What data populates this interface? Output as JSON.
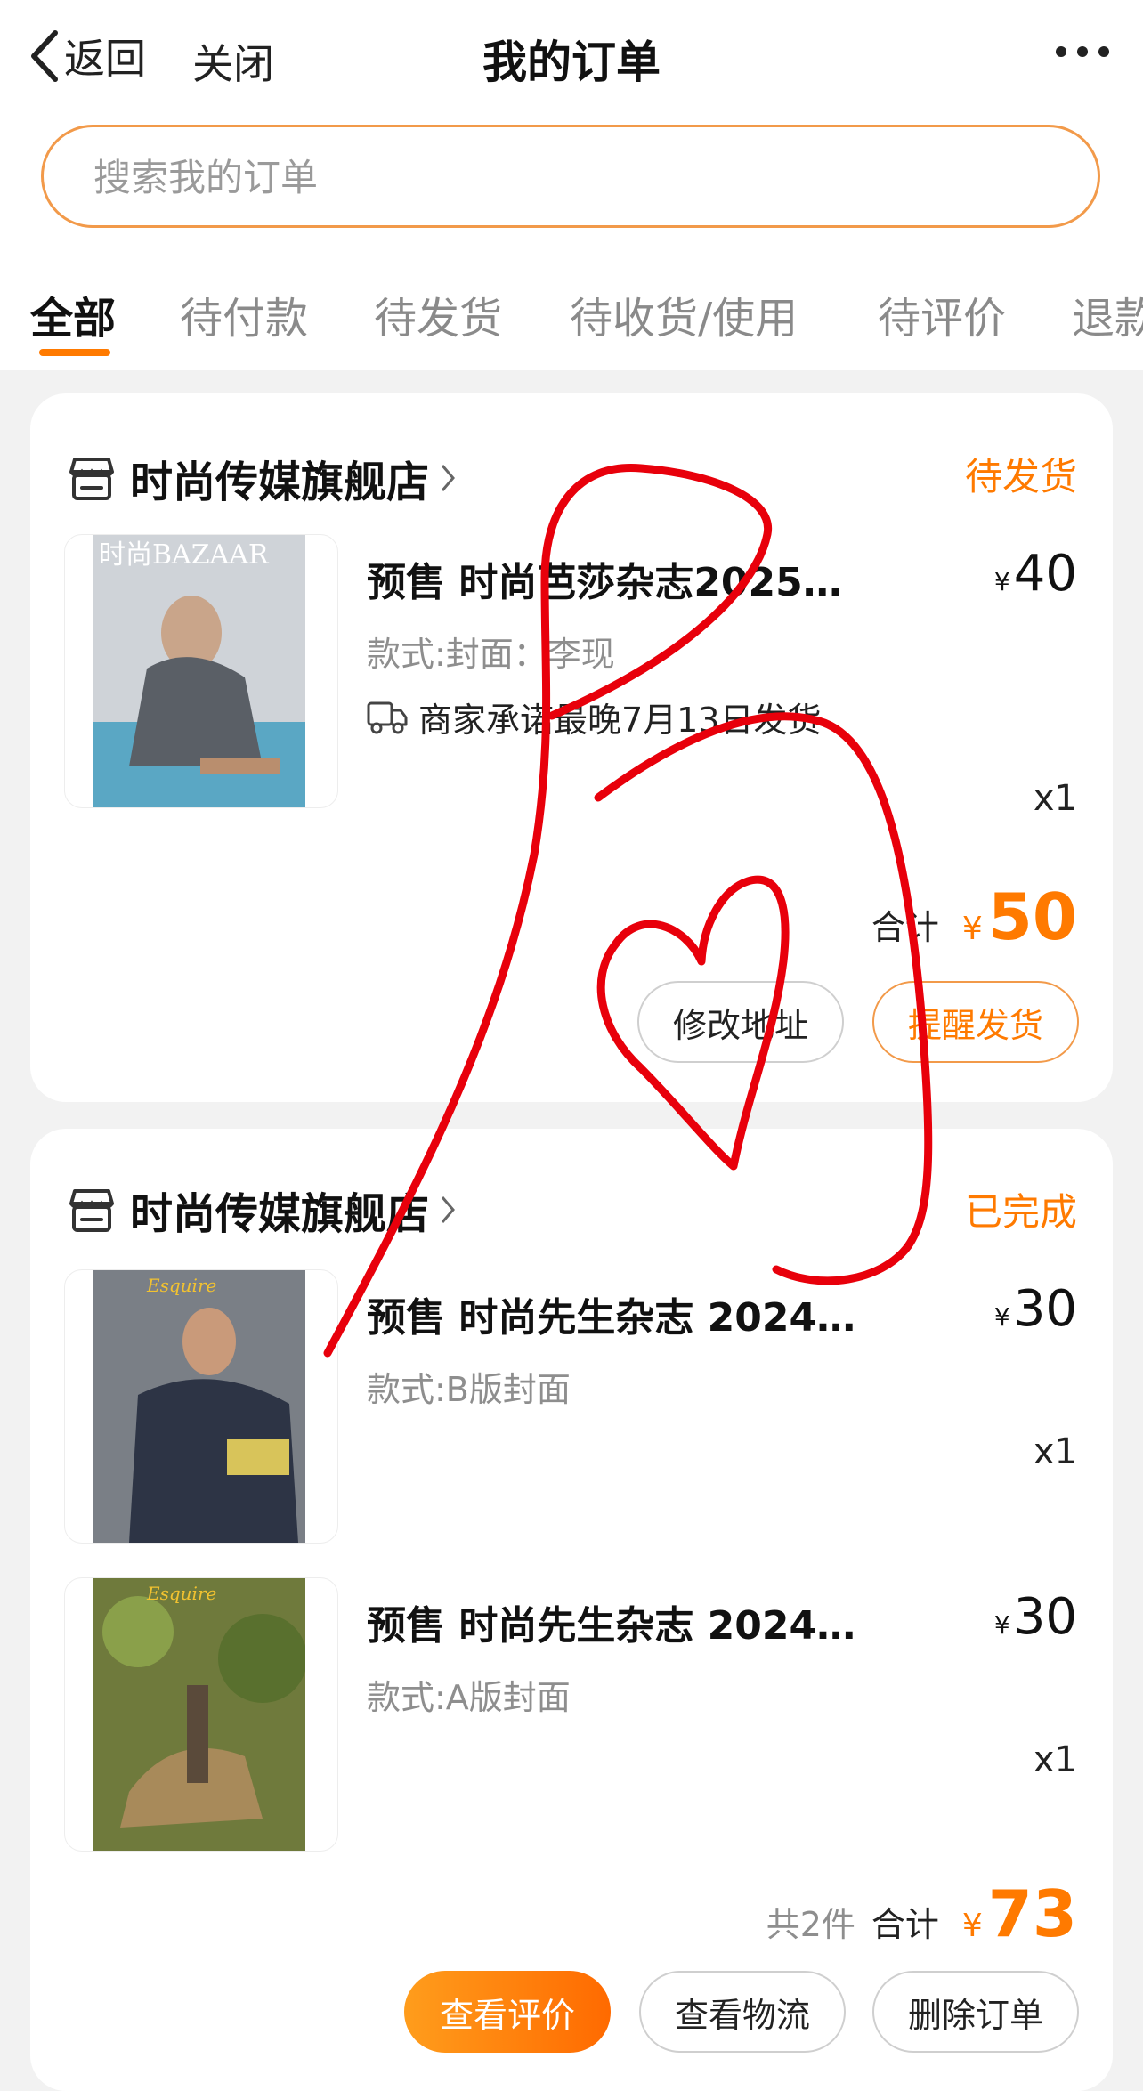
{
  "nav": {
    "back_label": "返回",
    "close_label": "关闭",
    "title": "我的订单",
    "more_icon": "more-dots-icon"
  },
  "search": {
    "placeholder": "搜索我的订单",
    "value": ""
  },
  "tabs": [
    {
      "label": "全部",
      "active": true
    },
    {
      "label": "待付款",
      "active": false
    },
    {
      "label": "待发货",
      "active": false
    },
    {
      "label": "待收货/使用",
      "active": false
    },
    {
      "label": "待评价",
      "active": false
    },
    {
      "label": "退款",
      "active": false
    }
  ],
  "colors": {
    "accent": "#ff7a00",
    "scribble": "#e8000b"
  },
  "orders": [
    {
      "store_name": "时尚传媒旗舰店",
      "status": "待发货",
      "items": [
        {
          "title": "预售 时尚芭莎杂志2025…",
          "variant": "款式:封面：李现",
          "promise": "商家承诺最晚7月13日发货",
          "price_symbol": "¥",
          "price": "40",
          "qty": "x1"
        }
      ],
      "total_label": "合计",
      "total_symbol": "¥",
      "total": "50",
      "buttons": [
        "修改地址",
        "提醒发货"
      ]
    },
    {
      "store_name": "时尚传媒旗舰店",
      "status": "已完成",
      "items": [
        {
          "title": "预售 时尚先生杂志 2024…",
          "variant": "款式:B版封面",
          "price_symbol": "¥",
          "price": "30",
          "qty": "x1"
        },
        {
          "title": "预售 时尚先生杂志 2024…",
          "variant": "款式:A版封面",
          "price_symbol": "¥",
          "price": "30",
          "qty": "x1"
        }
      ],
      "count_label": "共2件",
      "total_label": "合计",
      "total_symbol": "¥",
      "total": "73",
      "buttons": [
        "查看评价",
        "查看物流",
        "删除订单"
      ]
    }
  ]
}
